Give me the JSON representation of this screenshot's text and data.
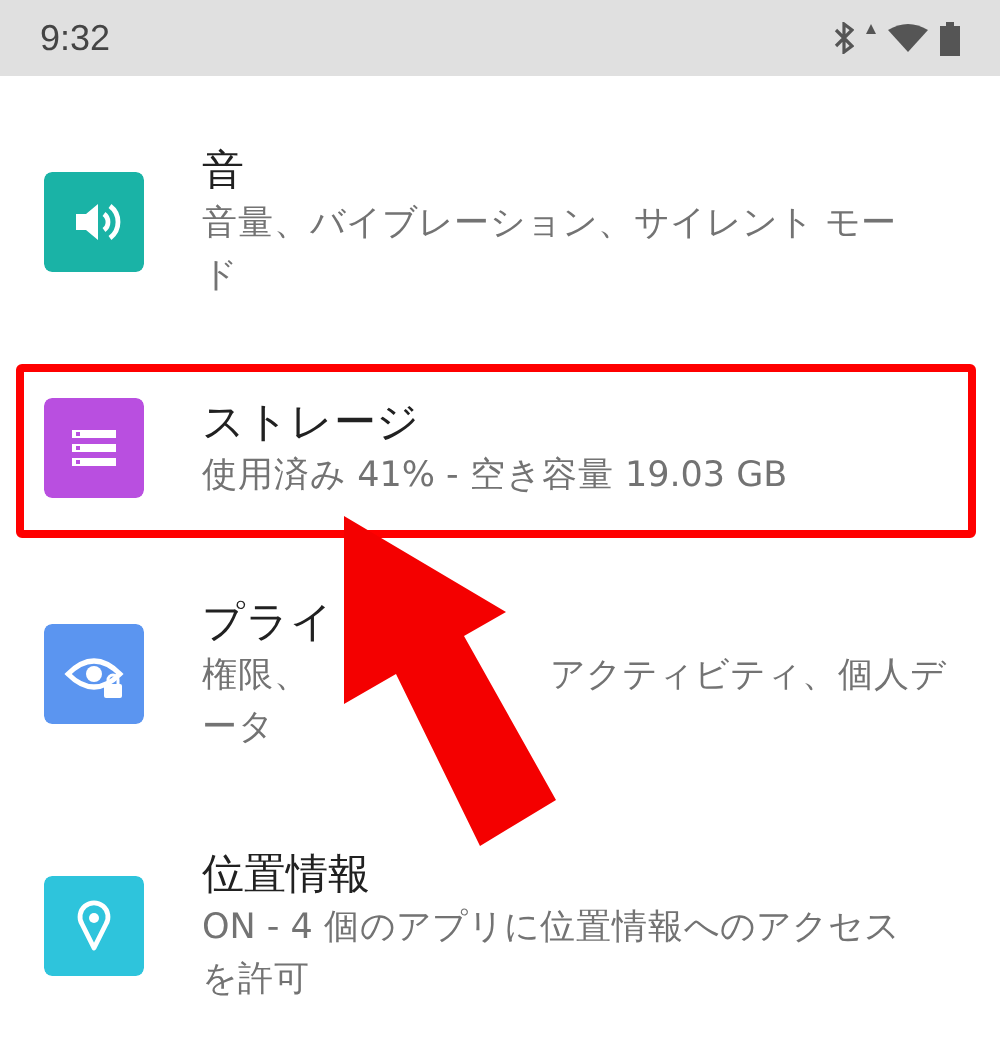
{
  "status_bar": {
    "time": "9:32"
  },
  "items": [
    {
      "title": "音",
      "subtitle_lines": [
        [
          "音量、バイブレーション、サイレント モー"
        ],
        [
          "ド"
        ]
      ],
      "color": "#1ab3a6",
      "highlighted": false
    },
    {
      "title": "ストレージ",
      "subtitle_lines": [
        [
          "使用済み 41% - 空き容量 19.03 GB"
        ]
      ],
      "color": "#b94fe0",
      "highlighted": true
    },
    {
      "title": "プライ",
      "subtitle_lines": [
        [
          "権限、",
          "アクティビティ、個人デ"
        ],
        [
          "ータ"
        ]
      ],
      "color": "#5b95f0",
      "highlighted": false
    },
    {
      "title": "位置情報",
      "subtitle_lines": [
        [
          "ON - 4 個のアプリに位置情報へのアクセス"
        ],
        [
          "を許可"
        ]
      ],
      "color": "#2ec4dc",
      "highlighted": false
    }
  ]
}
